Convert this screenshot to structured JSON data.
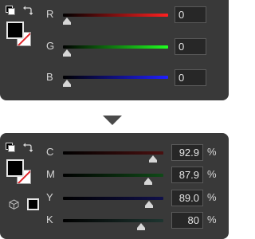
{
  "rgb_panel": {
    "channels": [
      {
        "label": "R",
        "value": "0",
        "level": 0,
        "gradient": [
          "#000000",
          "#ff2020"
        ]
      },
      {
        "label": "G",
        "value": "0",
        "level": 0,
        "gradient": [
          "#000000",
          "#20ff20"
        ]
      },
      {
        "label": "B",
        "value": "0",
        "level": 0,
        "gradient": [
          "#000000",
          "#2020ff"
        ]
      }
    ]
  },
  "cmyk_panel": {
    "unit": "%",
    "channels": [
      {
        "label": "C",
        "value": "92.9",
        "level": 0.929,
        "gradient": [
          "#000000",
          "#4a1010"
        ]
      },
      {
        "label": "M",
        "value": "87.9",
        "level": 0.879,
        "gradient": [
          "#000000",
          "#104a18"
        ]
      },
      {
        "label": "Y",
        "value": "89.0",
        "level": 0.89,
        "gradient": [
          "#000000",
          "#10104a"
        ]
      },
      {
        "label": "K",
        "value": "80",
        "level": 0.8,
        "gradient": [
          "#000000",
          "#1e3530"
        ]
      }
    ]
  },
  "colors": {
    "panel_bg": "#393939",
    "foreground": "#000000",
    "background": "#ffffff",
    "none_slash": "#e0262b"
  },
  "icons": {
    "default_colors": "default-colors-icon",
    "swap": "swap-colors-icon",
    "gamut_warning": "cube-icon"
  }
}
